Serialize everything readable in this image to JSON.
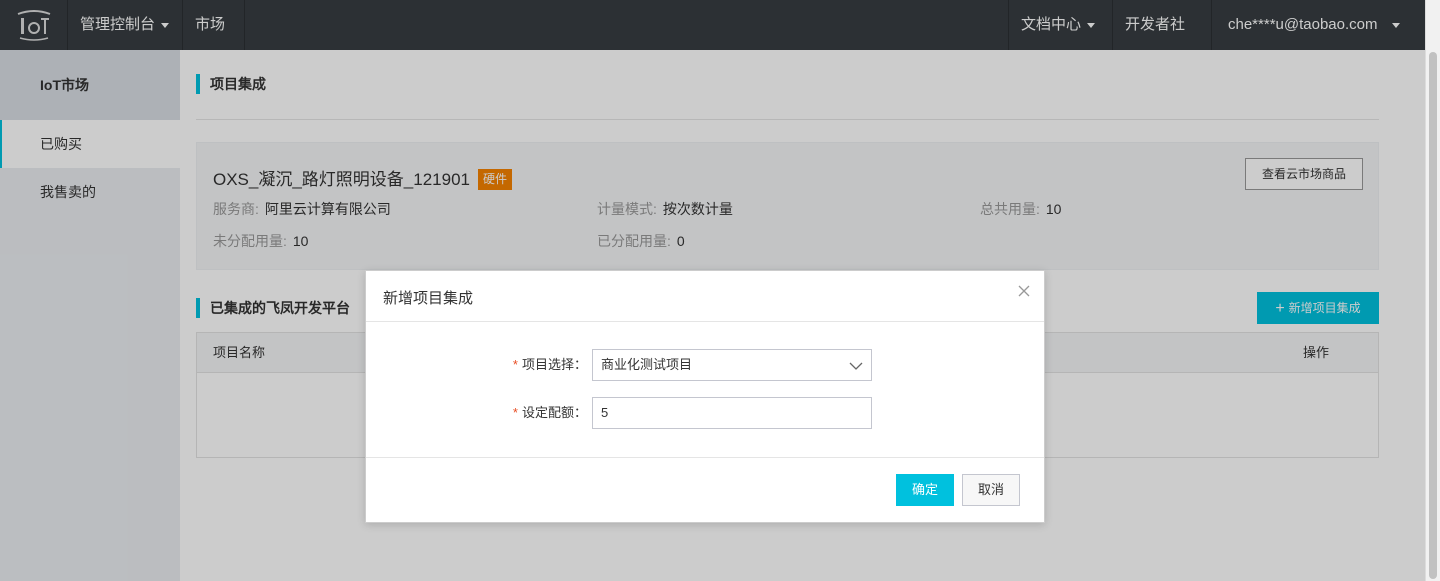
{
  "topbar": {
    "console_label": "管理控制台",
    "market_label": "市场",
    "docs_label": "文档中心",
    "community_label": "开发者社区",
    "account_label": "che****u@taobao.com"
  },
  "sidebar": {
    "title": "IoT市场",
    "items": [
      {
        "label": "已购买"
      },
      {
        "label": "我售卖的"
      }
    ]
  },
  "main": {
    "section_title": "项目集成",
    "product": {
      "name": "OXS_凝沉_路灯照明设备_121901",
      "badge": "硬件",
      "view_button": "查看云市场商品",
      "provider_key": "服务商:",
      "provider_val": "阿里云计算有限公司",
      "billing_key": "计量模式:",
      "billing_val": "按次数计量",
      "total_key": "总共用量:",
      "total_val": "10",
      "unassigned_key": "未分配用量:",
      "unassigned_val": "10",
      "assigned_key": "已分配用量:",
      "assigned_val": "0"
    },
    "integrated_title": "已集成的飞凤开发平台",
    "add_button": "新增项目集成",
    "table": {
      "col_name": "项目名称",
      "col_ops": "操作"
    }
  },
  "dialog": {
    "title": "新增项目集成",
    "project_label": "项目选择：",
    "project_value": "商业化测试项目",
    "quota_label": "设定配额：",
    "quota_value": "5",
    "required_mark": "*",
    "ok": "确定",
    "cancel": "取消"
  },
  "colors": {
    "accent": "#00c1de",
    "topbar": "#373d41",
    "badge": "#f68300"
  }
}
